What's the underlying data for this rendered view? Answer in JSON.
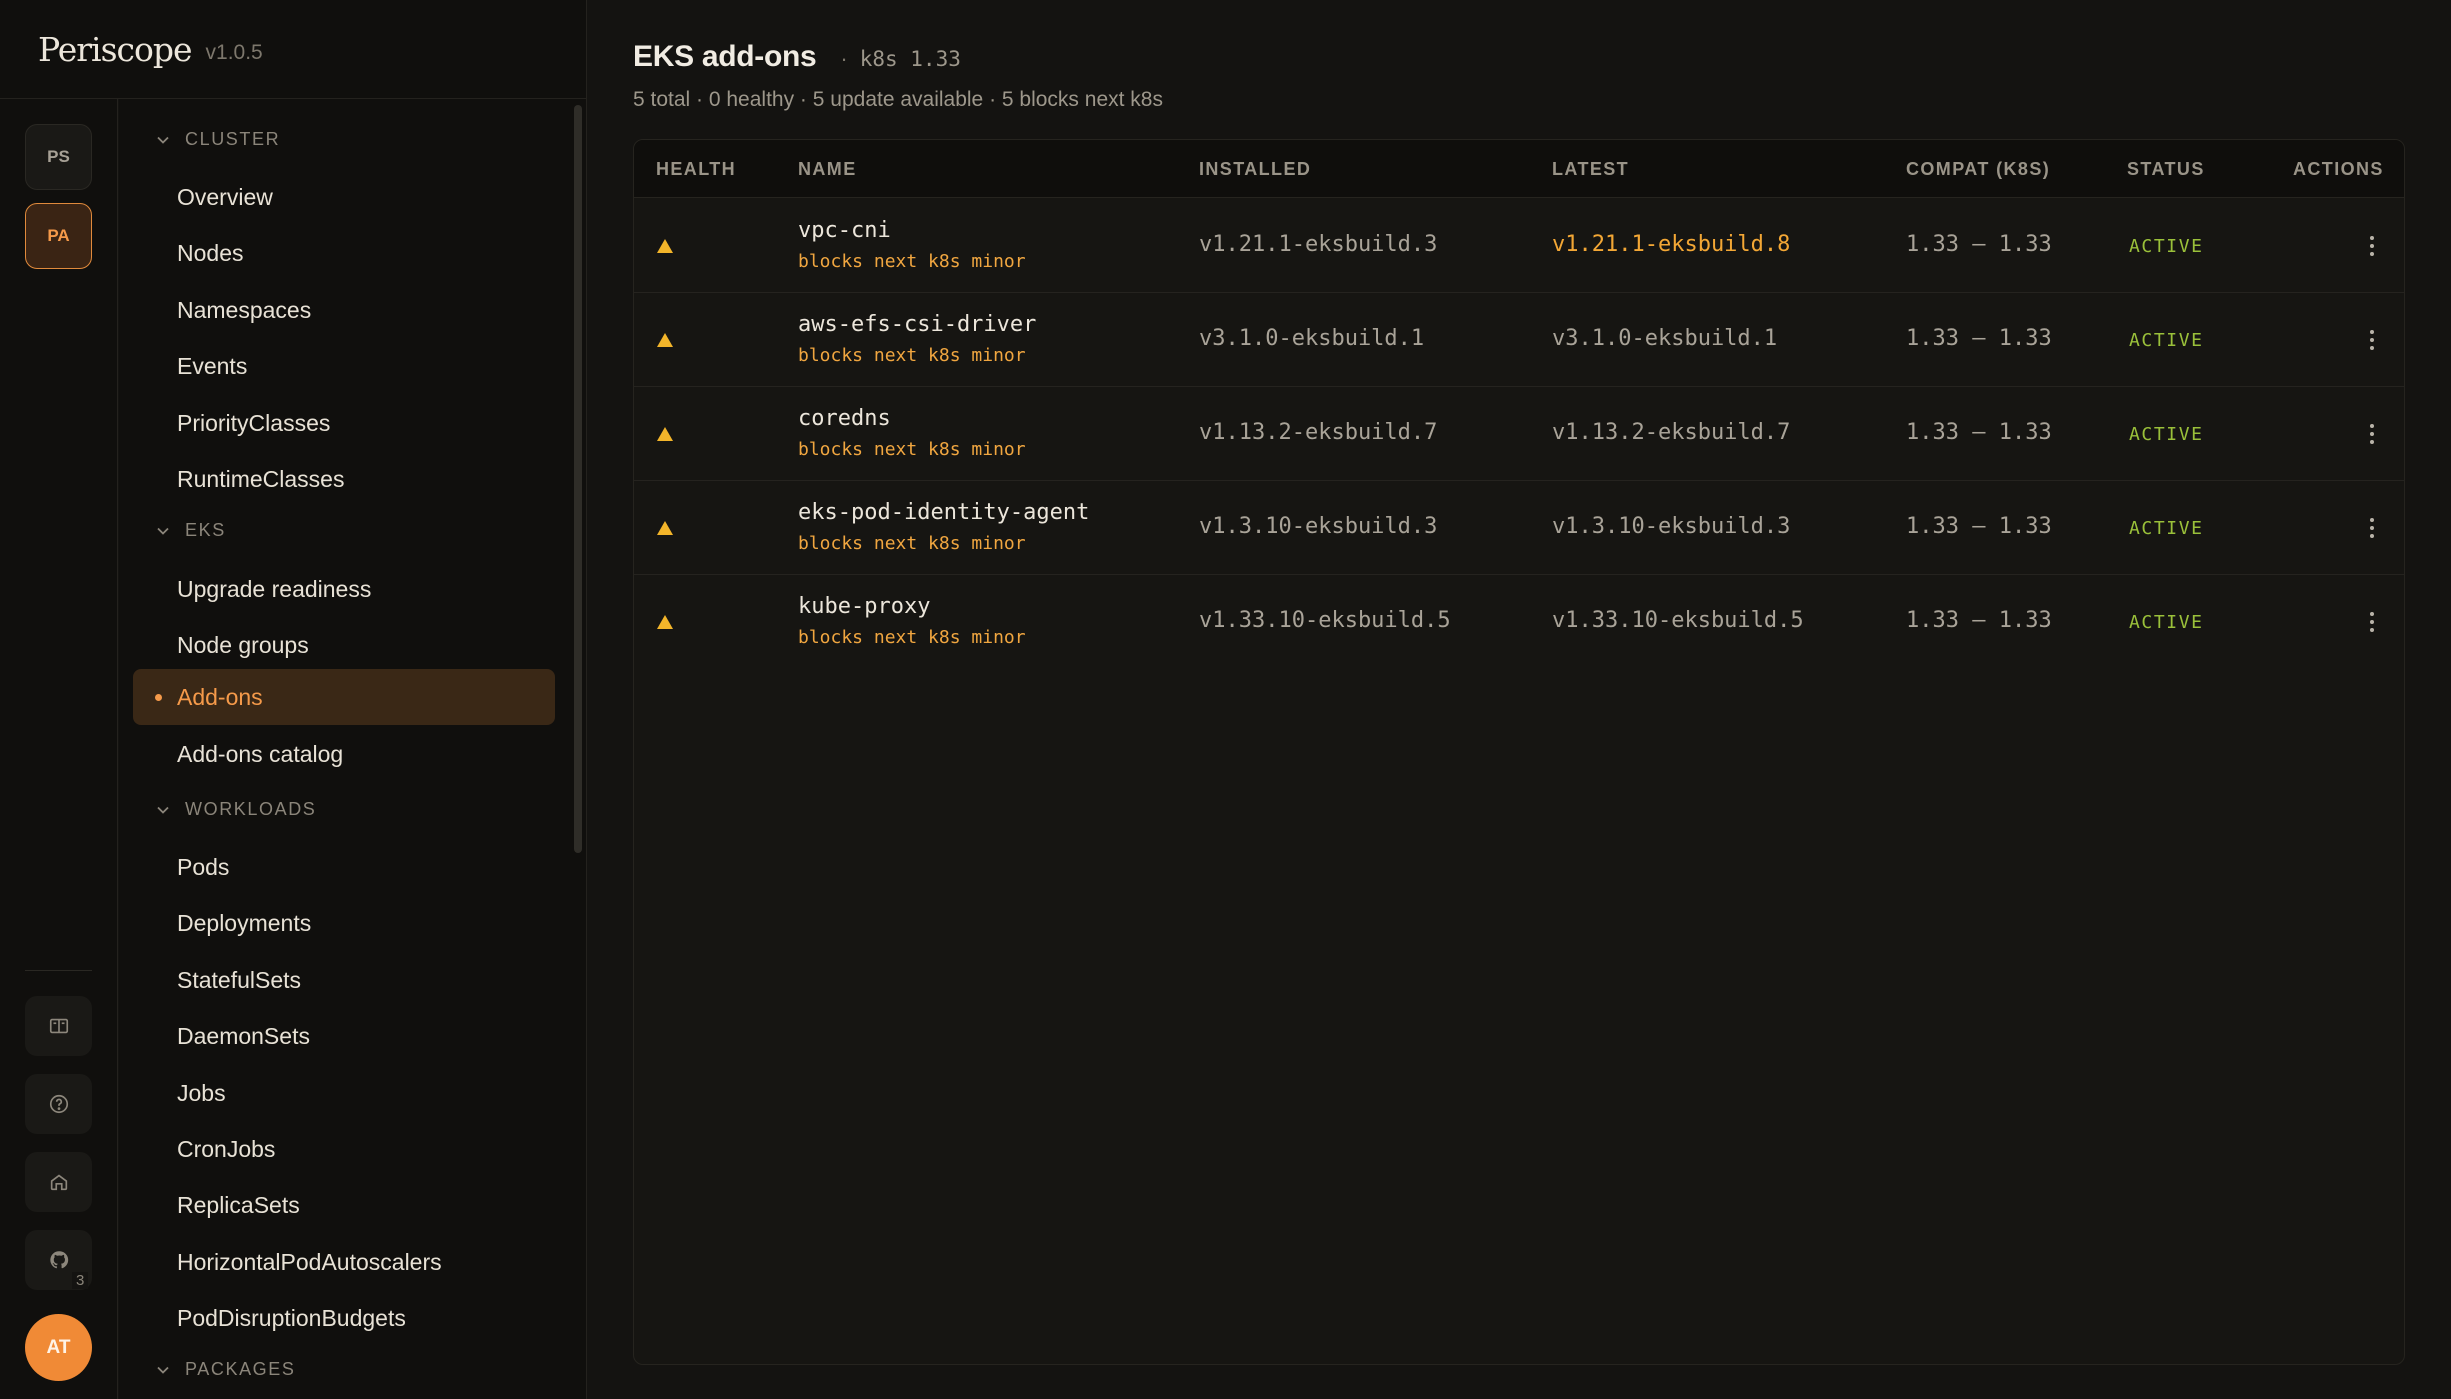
{
  "app": {
    "name": "Periscope",
    "version": "v1.0.5"
  },
  "rail": {
    "workspaces": [
      {
        "label": "PS",
        "active": false
      },
      {
        "label": "PA",
        "active": true
      }
    ],
    "icons": [
      "book-icon",
      "help-circle-icon",
      "home-icon",
      "github-icon"
    ],
    "github_badge": "3",
    "avatar": "AT"
  },
  "sidebar": {
    "sections": [
      {
        "title": "CLUSTER",
        "items": [
          "Overview",
          "Nodes",
          "Namespaces",
          "Events",
          "PriorityClasses",
          "RuntimeClasses"
        ]
      },
      {
        "title": "EKS",
        "items": [
          "Upgrade readiness",
          "Node groups",
          "Add-ons",
          "Add-ons catalog"
        ]
      },
      {
        "title": "WORKLOADS",
        "items": [
          "Pods",
          "Deployments",
          "StatefulSets",
          "DaemonSets",
          "Jobs",
          "CronJobs",
          "ReplicaSets",
          "HorizontalPodAutoscalers",
          "PodDisruptionBudgets"
        ]
      },
      {
        "title": "PACKAGES",
        "items": []
      }
    ],
    "active_item": "Add-ons"
  },
  "page": {
    "title": "EKS add-ons",
    "separator": "·",
    "k8s_version": "k8s 1.33",
    "summary": "5 total · 0 healthy · 5 update available · 5 blocks next k8s"
  },
  "table": {
    "columns": [
      "HEALTH",
      "NAME",
      "INSTALLED",
      "LATEST",
      "COMPAT (K8S)",
      "STATUS",
      "ACTIONS"
    ],
    "rows": [
      {
        "health": "warning",
        "name": "vpc-cni",
        "note": "blocks next k8s minor",
        "installed": "v1.21.1-eksbuild.3",
        "latest": "v1.21.1-eksbuild.8",
        "latest_is_update": true,
        "compat": "1.33 – 1.33",
        "status": "ACTIVE"
      },
      {
        "health": "warning",
        "name": "aws-efs-csi-driver",
        "note": "blocks next k8s minor",
        "installed": "v3.1.0-eksbuild.1",
        "latest": "v3.1.0-eksbuild.1",
        "latest_is_update": false,
        "compat": "1.33 – 1.33",
        "status": "ACTIVE"
      },
      {
        "health": "warning",
        "name": "coredns",
        "note": "blocks next k8s minor",
        "installed": "v1.13.2-eksbuild.7",
        "latest": "v1.13.2-eksbuild.7",
        "latest_is_update": false,
        "compat": "1.33 – 1.33",
        "status": "ACTIVE"
      },
      {
        "health": "warning",
        "name": "eks-pod-identity-agent",
        "note": "blocks next k8s minor",
        "installed": "v1.3.10-eksbuild.3",
        "latest": "v1.3.10-eksbuild.3",
        "latest_is_update": false,
        "compat": "1.33 – 1.33",
        "status": "ACTIVE"
      },
      {
        "health": "warning",
        "name": "kube-proxy",
        "note": "blocks next k8s minor",
        "installed": "v1.33.10-eksbuild.5",
        "latest": "v1.33.10-eksbuild.5",
        "latest_is_update": false,
        "compat": "1.33 – 1.33",
        "status": "ACTIVE"
      }
    ]
  },
  "colors": {
    "accent": "#f59a4a",
    "warning": "#f3b52a",
    "status_active": "#9ac03a",
    "background": "#141311"
  }
}
